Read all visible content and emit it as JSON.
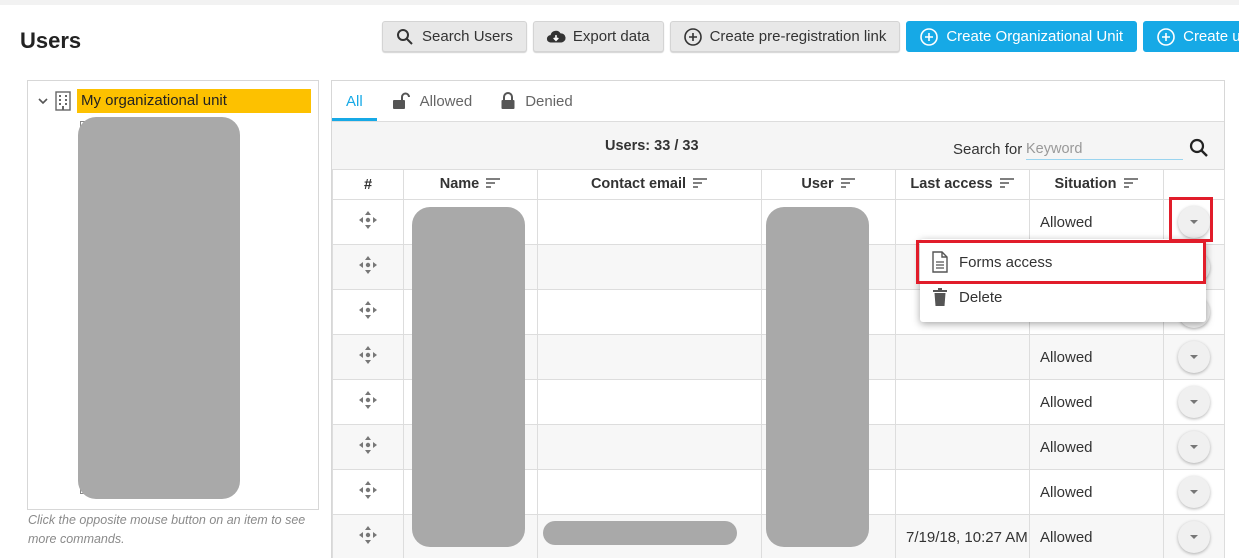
{
  "page": {
    "title": "Users"
  },
  "toolbar": {
    "search_users": "Search Users",
    "export_data": "Export data",
    "create_prereg": "Create pre-registration link",
    "create_ou": "Create Organizational Unit",
    "create_user": "Create user"
  },
  "tree": {
    "root_label": "My organizational unit",
    "hint": "Click the opposite mouse button on an item to see more commands."
  },
  "tabs": {
    "all": "All",
    "allowed": "Allowed",
    "denied": "Denied"
  },
  "grid": {
    "users_count": "Users: 33 / 33",
    "search_label": "Search for",
    "search_placeholder": "Keyword",
    "columns": {
      "num": "#",
      "name": "Name",
      "email": "Contact email",
      "user": "User",
      "last_access": "Last access",
      "situation": "Situation"
    },
    "rows": [
      {
        "last_access": "",
        "situation": "Allowed"
      },
      {
        "last_access": "",
        "situation": ""
      },
      {
        "last_access": "",
        "situation": ""
      },
      {
        "last_access": "",
        "situation": "Allowed"
      },
      {
        "last_access": "",
        "situation": "Allowed"
      },
      {
        "last_access": "",
        "situation": "Allowed"
      },
      {
        "last_access": "",
        "situation": "Allowed"
      },
      {
        "last_access": "7/19/18, 10:27 AM",
        "situation": "Allowed"
      }
    ]
  },
  "context_menu": {
    "forms_access": "Forms access",
    "delete": "Delete"
  },
  "colors": {
    "accent": "#16a9e6",
    "tree_selected": "#fdc100",
    "highlight": "#e11d2a"
  }
}
